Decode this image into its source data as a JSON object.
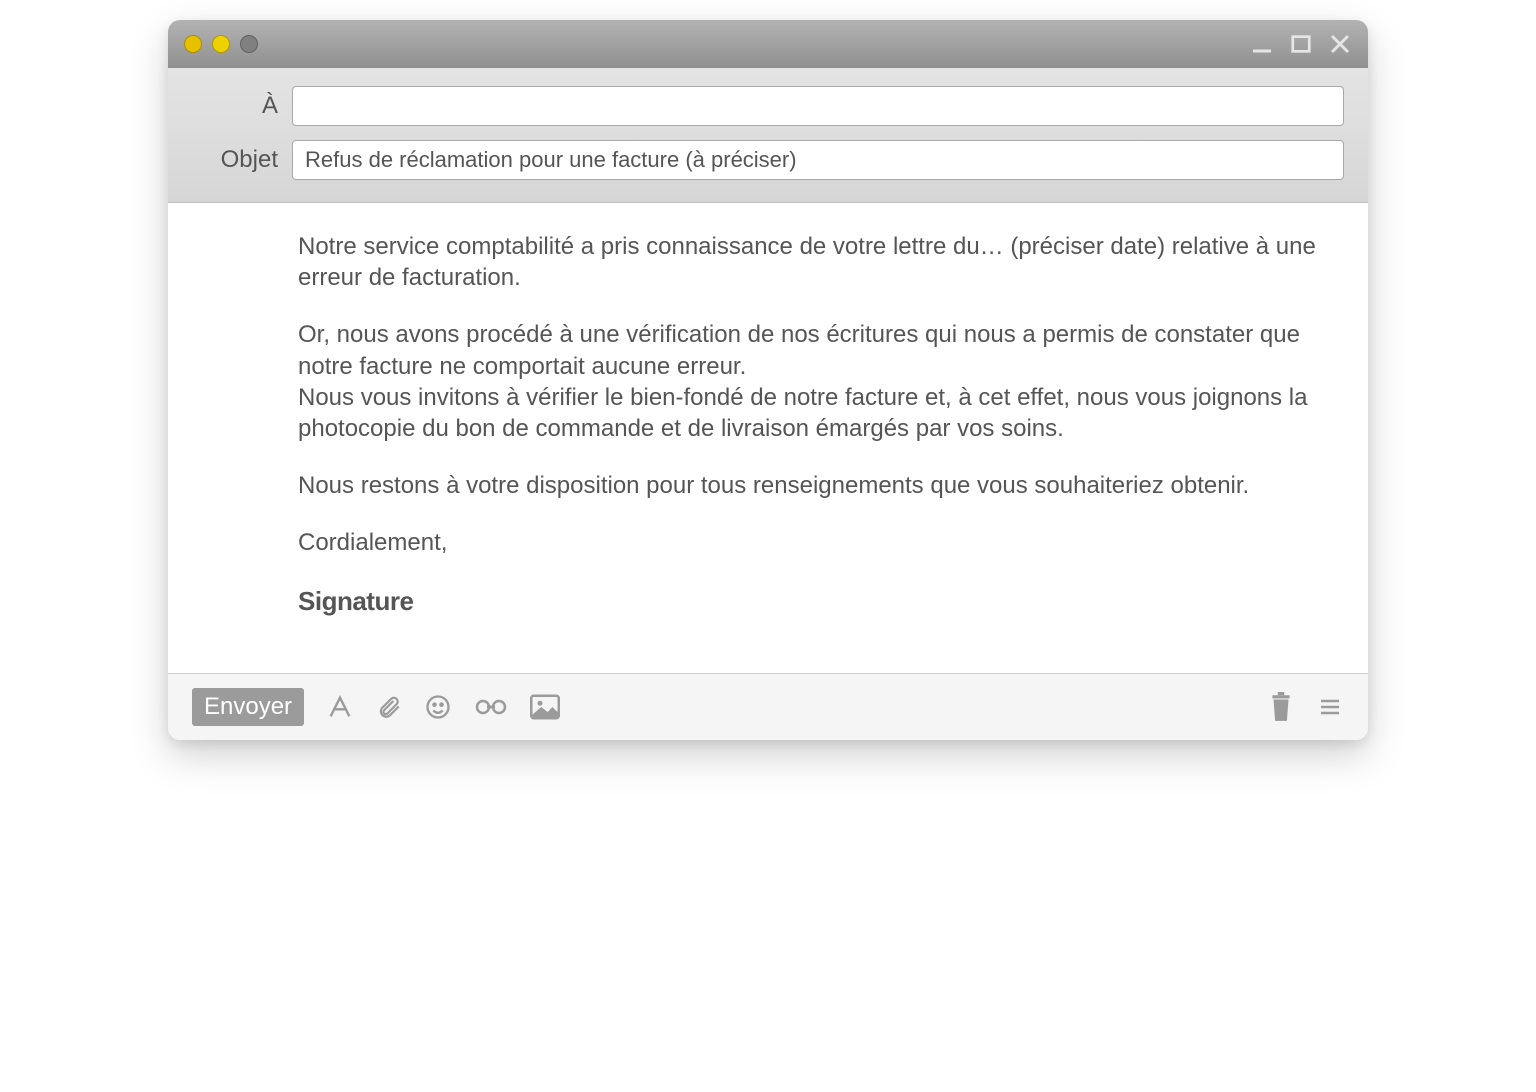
{
  "header": {
    "to_label": "À",
    "to_value": "",
    "subject_label": "Objet",
    "subject_value": "Refus de réclamation pour une facture (à préciser)"
  },
  "body": {
    "p1": "Notre service comptabilité a pris connaissance de votre lettre du… (préciser date) relative à une erreur de facturation.",
    "p2a": "Or, nous avons procédé à une vérification de nos écritures qui nous a permis de constater que notre facture ne comportait aucune erreur.",
    "p2b": "Nous vous invitons à vérifier le bien-fondé de notre facture et, à cet effet, nous vous joignons la photocopie du bon de commande et de livraison émargés par vos soins.",
    "p3": "Nous restons à votre disposition pour tous renseignements que vous souhaiteriez obtenir.",
    "closing": "Cordialement,",
    "signature": "Signature"
  },
  "toolbar": {
    "send_label": "Envoyer"
  }
}
